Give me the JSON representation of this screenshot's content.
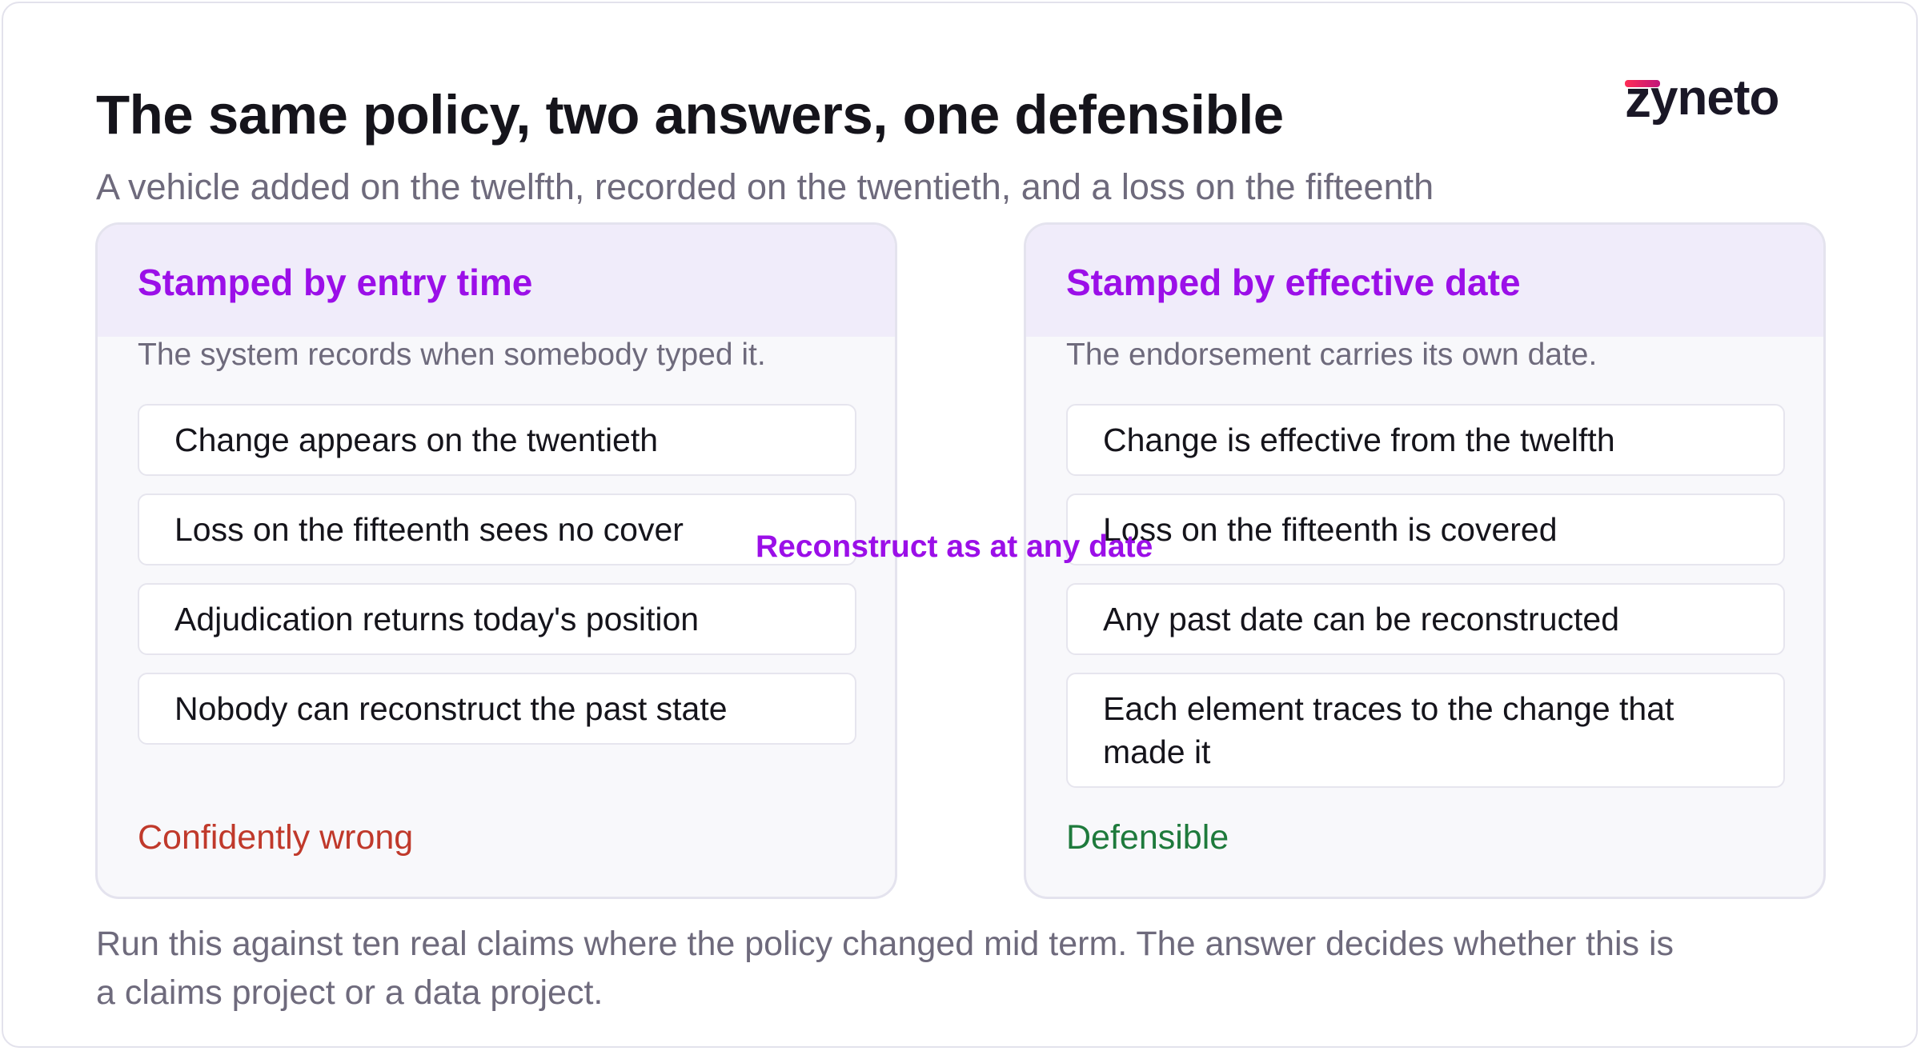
{
  "header": {
    "title": "The same policy, two answers, one defensible",
    "subtitle": "A vehicle added on the twelfth, recorded on the twentieth, and a loss on the fifteenth"
  },
  "logo": {
    "text": "zyneto",
    "icon": "zyneto-logo"
  },
  "cards": [
    {
      "title": "Stamped by entry time",
      "description": "The system records when somebody typed it.",
      "items": [
        "Change appears on the twentieth",
        "Loss on the fifteenth sees no cover",
        "Adjudication returns today's position",
        "Nobody can reconstruct the past state"
      ],
      "verdict": "Confidently wrong"
    },
    {
      "title": "Stamped by effective date",
      "description": "The endorsement carries its own date.",
      "items": [
        "Change is effective from the twelfth",
        "Loss on the fifteenth is covered",
        "Any past date can be reconstructed",
        "Each element traces to the change that made it"
      ],
      "verdict": "Defensible"
    }
  ],
  "connector_label": "Reconstruct as at any date",
  "footer": "Run this against ten real claims where the policy changed mid term. The answer decides whether this is a claims project or a data project.",
  "colors": {
    "accent": "#9b0fe8",
    "wrong": "#c0392b",
    "defensible": "#1e7a3c",
    "header_band": "#f0ecfa"
  }
}
